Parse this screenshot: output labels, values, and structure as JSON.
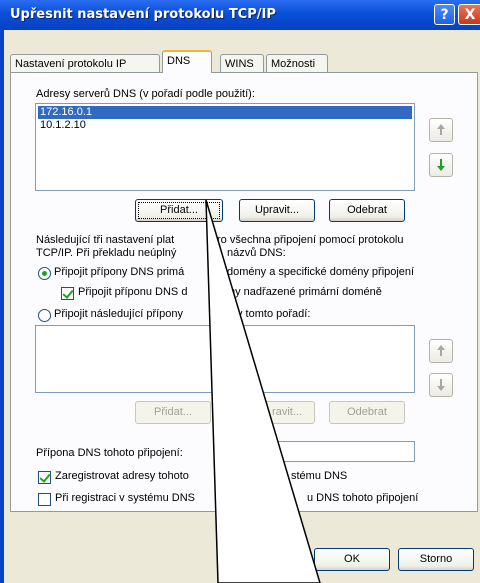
{
  "window": {
    "title": "Upřesnit nastavení protokolu TCP/IP",
    "help_glyph": "?",
    "close_glyph": "X"
  },
  "tabs": [
    {
      "label": "Nastavení protokolu IP",
      "active": false
    },
    {
      "label": "DNS",
      "active": true
    },
    {
      "label": "WINS",
      "active": false
    },
    {
      "label": "Možnosti",
      "active": false
    }
  ],
  "dns": {
    "servers_label": "Adresy serverů DNS (v pořadí podle použití):",
    "servers": [
      "172.16.0.1",
      "10.1.2.10"
    ],
    "add_label": "Přidat...",
    "edit_label": "Upravit...",
    "remove_label": "Odebrat",
    "description_line1": "Následující tři nastavení plat",
    "description_line1b": "ro všechna připojení pomocí protokolu",
    "description_line2": "TCP/IP. Při překladu neúplný",
    "description_line2b": "názvů DNS:",
    "radio1_label_a": "Připojit přípony DNS primá",
    "radio1_label_b": "domény a specifické domény připojení",
    "check_parent_a": "Připojit příponu DNS d",
    "check_parent_b": "ny nadřazené primární doméně",
    "radio2_label_a": "Připojit následující přípony",
    "radio2_label_b": "v tomto pořadí:",
    "suffix_add_label": "Přidat...",
    "suffix_edit_label": "ravit...",
    "suffix_remove_label": "Odebrat",
    "connection_suffix_label": "Přípona DNS tohoto připojení:",
    "register_label_a": "Zaregistrovat adresy tohoto",
    "register_label_b": "stému DNS",
    "use_suffix_label_a": "Při registraci v systému DNS",
    "use_suffix_label_b": "u DNS tohoto připojení"
  },
  "footer": {
    "ok_label": "OK",
    "cancel_label": "Storno"
  },
  "colors": {
    "title_bar": "#0a4fd8",
    "dialog_bg": "#ece9d8",
    "selection": "#316ac5",
    "arrow_green": "#21a121"
  }
}
